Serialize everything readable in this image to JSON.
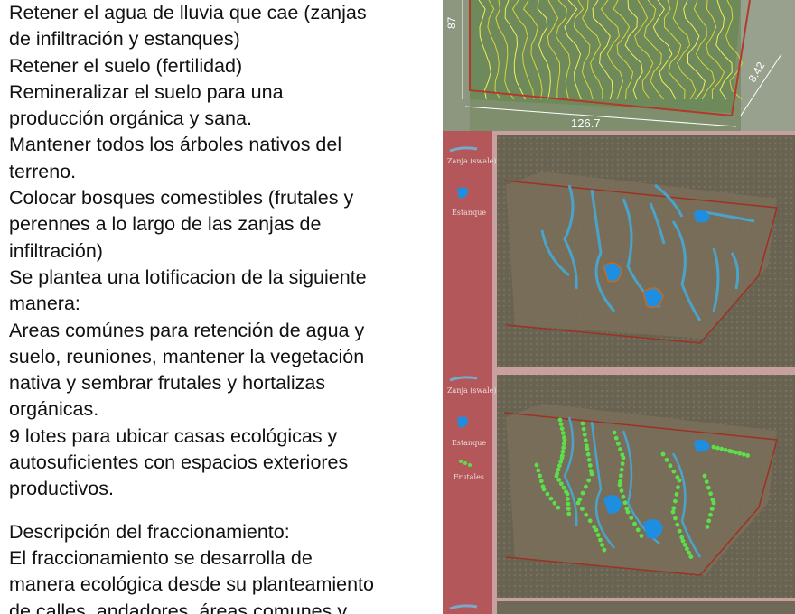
{
  "document": {
    "lines": [
      "Retener el agua de lluvia que cae (zanjas",
      "de infiltración y estanques)",
      "Retener el suelo (fertilidad)",
      "Remineralizar el suelo para una",
      "producción orgánica y sana.",
      "Mantener todos los árboles nativos del",
      "terreno.",
      "Colocar bosques comestibles (frutales y",
      "perennes a lo largo de las zanjas de",
      "infiltración)",
      "Se plantea una lotificacion de la siguiente",
      "manera:",
      "Areas comúnes para retención de agua y",
      "suelo, reuniones, mantener la vegetación",
      "nativa y sembrar frutales y hortalizas",
      "orgánicas.",
      "9 lotes para ubicar casas ecológicas y",
      "autosuficientes con espacios exteriores",
      "productivos."
    ],
    "lines2": [
      "Descripción del fraccionamiento:",
      "El fraccionamiento se desarrolla de",
      "manera ecológica desde su planteamiento",
      "de calles, andadores, áreas comunes y"
    ]
  },
  "topo_map": {
    "dim_left": "87",
    "dim_right": "8.42",
    "dim_bottom": "126.7"
  },
  "map_legend_1": {
    "swale": "Zanja (swale)",
    "pond": "Estanque"
  },
  "map_legend_2": {
    "swale": "Zanja (swale)",
    "pond": "Estanque",
    "fruit": "Frutales"
  },
  "colors": {
    "legend_bg": "#b4575a",
    "panel_border": "#c9a0a0",
    "swale": "#4aa3c8",
    "pond": "#1e8fe0",
    "fruit": "#5be04a",
    "contour": "#e8e23a",
    "boundary": "#9b2b1e"
  }
}
